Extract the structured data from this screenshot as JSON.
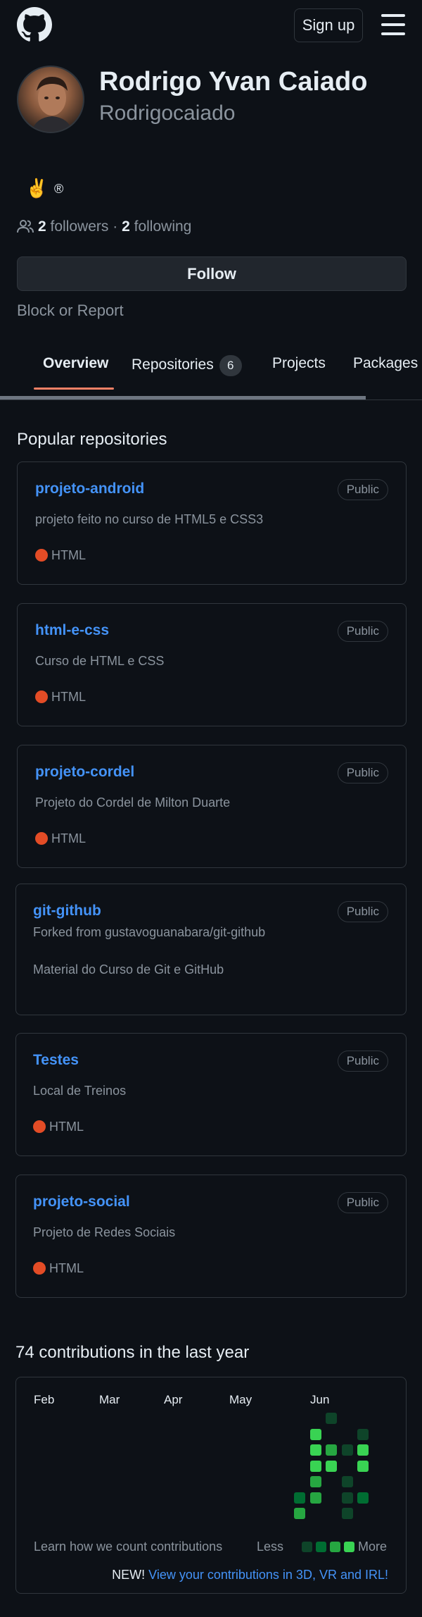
{
  "header": {
    "signup_label": "Sign up",
    "logo_icon": "github-logo-icon",
    "menu_icon": "hamburger-menu-icon"
  },
  "profile": {
    "name": "Rodrigo Yvan Caiado",
    "login": "Rodrigocaiado",
    "status_emoji": "✌️",
    "status_extra": "®",
    "followers_count": "2",
    "followers_label": "followers",
    "separator": "·",
    "following_count": "2",
    "following_label": "following",
    "follow_label": "Follow",
    "block_label": "Block or Report"
  },
  "tabs": [
    {
      "label": "Overview",
      "active": true
    },
    {
      "label": "Repositories",
      "count": "6"
    },
    {
      "label": "Projects"
    },
    {
      "label": "Packages"
    }
  ],
  "popular": {
    "title": "Popular repositories",
    "repos": [
      {
        "name": "projeto-android",
        "visibility": "Public",
        "description": "projeto feito no curso de HTML5 e CSS3",
        "language": "HTML"
      },
      {
        "name": "html-e-css",
        "visibility": "Public",
        "description": "Curso de HTML e CSS",
        "language": "HTML"
      },
      {
        "name": "projeto-cordel",
        "visibility": "Public",
        "description": "Projeto do Cordel de Milton Duarte",
        "language": "HTML"
      },
      {
        "name": "git-github",
        "visibility": "Public",
        "forked_from": "Forked from gustavoguanabara/git-github",
        "description": "Material do Curso de Git e GitHub"
      },
      {
        "name": "Testes",
        "visibility": "Public",
        "description": "Local de Treinos",
        "language": "HTML"
      },
      {
        "name": "projeto-social",
        "visibility": "Public",
        "description": "Projeto de Redes Sociais",
        "language": "HTML"
      }
    ]
  },
  "contributions": {
    "title": "74 contributions in the last year",
    "months": [
      "Feb",
      "Mar",
      "Apr",
      "May",
      "Jun"
    ],
    "learn_label": "Learn how we count contributions",
    "less_label": "Less",
    "more_label": "More",
    "new_label": "NEW!",
    "new_link": "View your contributions in 3D, VR and IRL!",
    "colors": {
      "l1": "#0e4429",
      "l2": "#006d32",
      "l3": "#26a641",
      "l4": "#39d353"
    },
    "cells": [
      {
        "week": 1,
        "day": 5,
        "level": 2
      },
      {
        "week": 1,
        "day": 6,
        "level": 3
      },
      {
        "week": 2,
        "day": 1,
        "level": 4
      },
      {
        "week": 2,
        "day": 2,
        "level": 4
      },
      {
        "week": 2,
        "day": 3,
        "level": 4
      },
      {
        "week": 2,
        "day": 4,
        "level": 3
      },
      {
        "week": 2,
        "day": 5,
        "level": 3
      },
      {
        "week": 3,
        "day": 0,
        "level": 1
      },
      {
        "week": 3,
        "day": 2,
        "level": 3
      },
      {
        "week": 3,
        "day": 3,
        "level": 4
      },
      {
        "week": 4,
        "day": 2,
        "level": 1
      },
      {
        "week": 4,
        "day": 4,
        "level": 1
      },
      {
        "week": 4,
        "day": 5,
        "level": 1
      },
      {
        "week": 4,
        "day": 6,
        "level": 1
      },
      {
        "week": 5,
        "day": 1,
        "level": 1
      },
      {
        "week": 5,
        "day": 2,
        "level": 4
      },
      {
        "week": 5,
        "day": 3,
        "level": 4
      },
      {
        "week": 5,
        "day": 5,
        "level": 2
      }
    ]
  }
}
